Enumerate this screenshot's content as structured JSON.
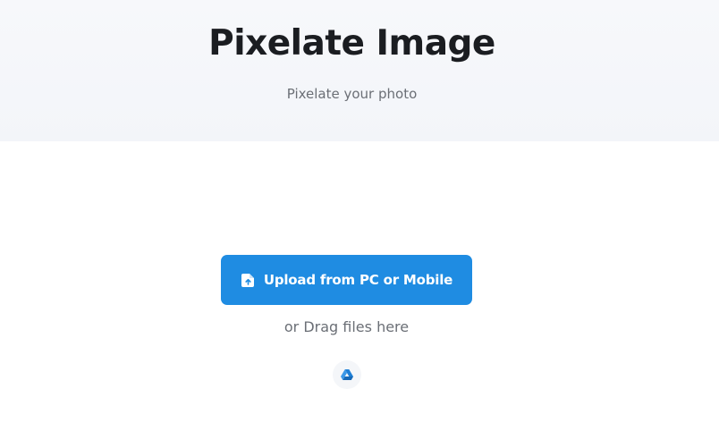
{
  "header": {
    "title": "Pixelate Image",
    "subtitle": "Pixelate your photo"
  },
  "upload": {
    "button_label": "Upload from PC or Mobile",
    "button_icon": "file-upload-icon",
    "drag_text": "or Drag files here",
    "cloud_icon": "google-drive-icon"
  },
  "colors": {
    "accent": "#1f8ce2",
    "title": "#1b1d21",
    "muted": "#6b6f76",
    "hero_bg": "#f5f7fa"
  }
}
